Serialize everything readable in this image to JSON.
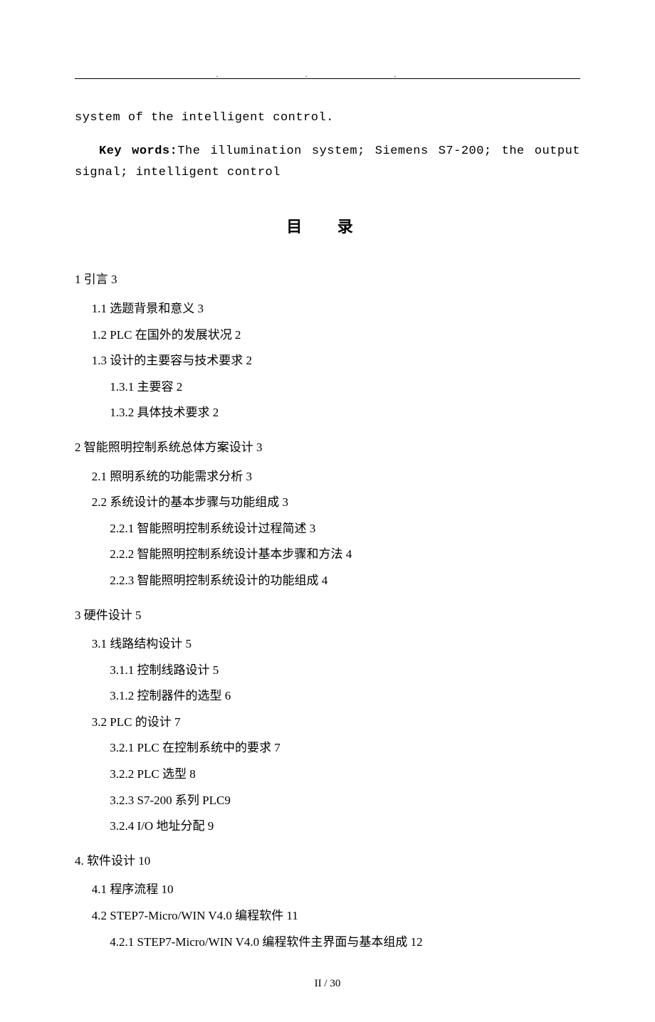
{
  "header": {
    "dots": ".   .   ."
  },
  "intro": {
    "line1": "system of the intelligent control.",
    "keywords_label": "Key words:",
    "keywords_text": "The illumination system; Siemens S7-200; the output signal; intelligent control"
  },
  "toc": {
    "title": "目 录",
    "items": [
      {
        "level": 1,
        "text": "1 引言 3"
      },
      {
        "level": 2,
        "text": "1.1 选题背景和意义 3"
      },
      {
        "level": 2,
        "text": "1.2 PLC 在国外的发展状况 2"
      },
      {
        "level": 2,
        "text": "1.3 设计的主要容与技术要求 2"
      },
      {
        "level": 3,
        "text": "1.3.1 主要容 2"
      },
      {
        "level": 3,
        "text": "1.3.2 具体技术要求 2"
      },
      {
        "level": 1,
        "text": "2 智能照明控制系统总体方案设计 3"
      },
      {
        "level": 2,
        "text": "2.1 照明系统的功能需求分析 3"
      },
      {
        "level": 2,
        "text": "2.2 系统设计的基本步骤与功能组成 3"
      },
      {
        "level": 3,
        "text": "2.2.1 智能照明控制系统设计过程简述 3"
      },
      {
        "level": 3,
        "text": "2.2.2 智能照明控制系统设计基本步骤和方法 4"
      },
      {
        "level": 3,
        "text": "2.2.3 智能照明控制系统设计的功能组成 4"
      },
      {
        "level": 1,
        "text": "3 硬件设计 5"
      },
      {
        "level": 2,
        "text": "3.1 线路结构设计 5"
      },
      {
        "level": 3,
        "text": "3.1.1 控制线路设计 5"
      },
      {
        "level": 3,
        "text": "3.1.2 控制器件的选型 6"
      },
      {
        "level": 2,
        "text": "3.2 PLC 的设计 7"
      },
      {
        "level": 3,
        "text": "3.2.1 PLC 在控制系统中的要求 7"
      },
      {
        "level": 3,
        "text": "3.2.2 PLC 选型 8"
      },
      {
        "level": 3,
        "text": "3.2.3 S7-200 系列 PLC9"
      },
      {
        "level": 3,
        "text": "3.2.4 I/O 地址分配 9"
      },
      {
        "level": 1,
        "text": "4. 软件设计 10"
      },
      {
        "level": 2,
        "text": "4.1 程序流程 10"
      },
      {
        "level": 2,
        "text": "4.2 STEP7-Micro/WIN V4.0 编程软件 11"
      },
      {
        "level": 3,
        "text": "4.2.1 STEP7-Micro/WIN V4.0 编程软件主界面与基本组成 12"
      }
    ]
  },
  "footer": {
    "page": "II / 30"
  }
}
